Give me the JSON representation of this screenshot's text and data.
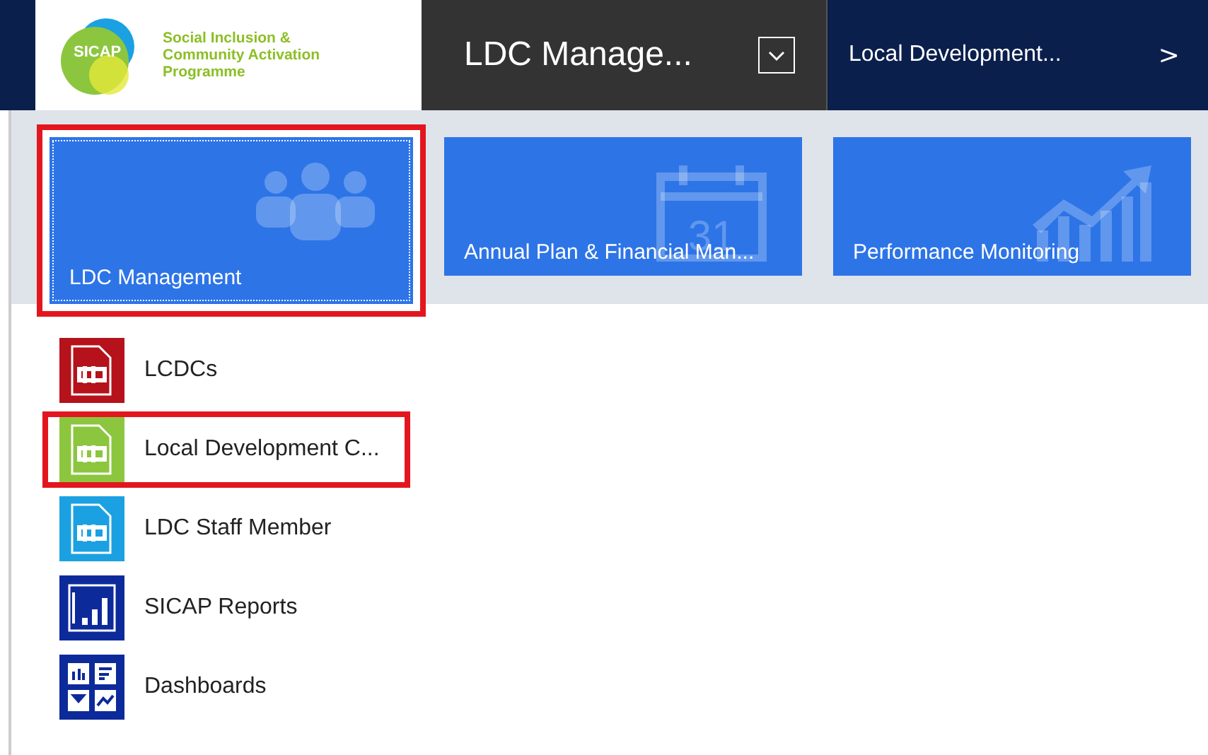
{
  "nav_bar": {
    "logo": {
      "badge": "SICAP",
      "name_lines": [
        "Social Inclusion &",
        "Community Activation",
        "Programme"
      ]
    },
    "area": {
      "label": "LDC Manage..."
    },
    "breadcrumb": {
      "label": "Local Development...",
      "chevron": ">"
    }
  },
  "tiles": [
    {
      "label": "LDC Management",
      "kind": "people",
      "selected": true,
      "highlighted": true
    },
    {
      "label": "Annual Plan & Financial Man...",
      "kind": "calendar",
      "icon_text": "31",
      "selected": false,
      "highlighted": false
    },
    {
      "label": "Performance Monitoring",
      "kind": "chart",
      "selected": false,
      "highlighted": false
    }
  ],
  "items": [
    {
      "label": "LCDCs",
      "kind": "entity",
      "color": "#b5121b",
      "highlighted": false
    },
    {
      "label": "Local Development C...",
      "kind": "entity",
      "color": "#8cc63f",
      "highlighted": true
    },
    {
      "label": "LDC Staff Member",
      "kind": "entity",
      "color": "#1ba1e2",
      "highlighted": false
    },
    {
      "label": "SICAP Reports",
      "kind": "report",
      "color": "#0d2a9b",
      "highlighted": false
    },
    {
      "label": "Dashboards",
      "kind": "dashboard",
      "color": "#0d2a9b",
      "highlighted": false
    }
  ]
}
